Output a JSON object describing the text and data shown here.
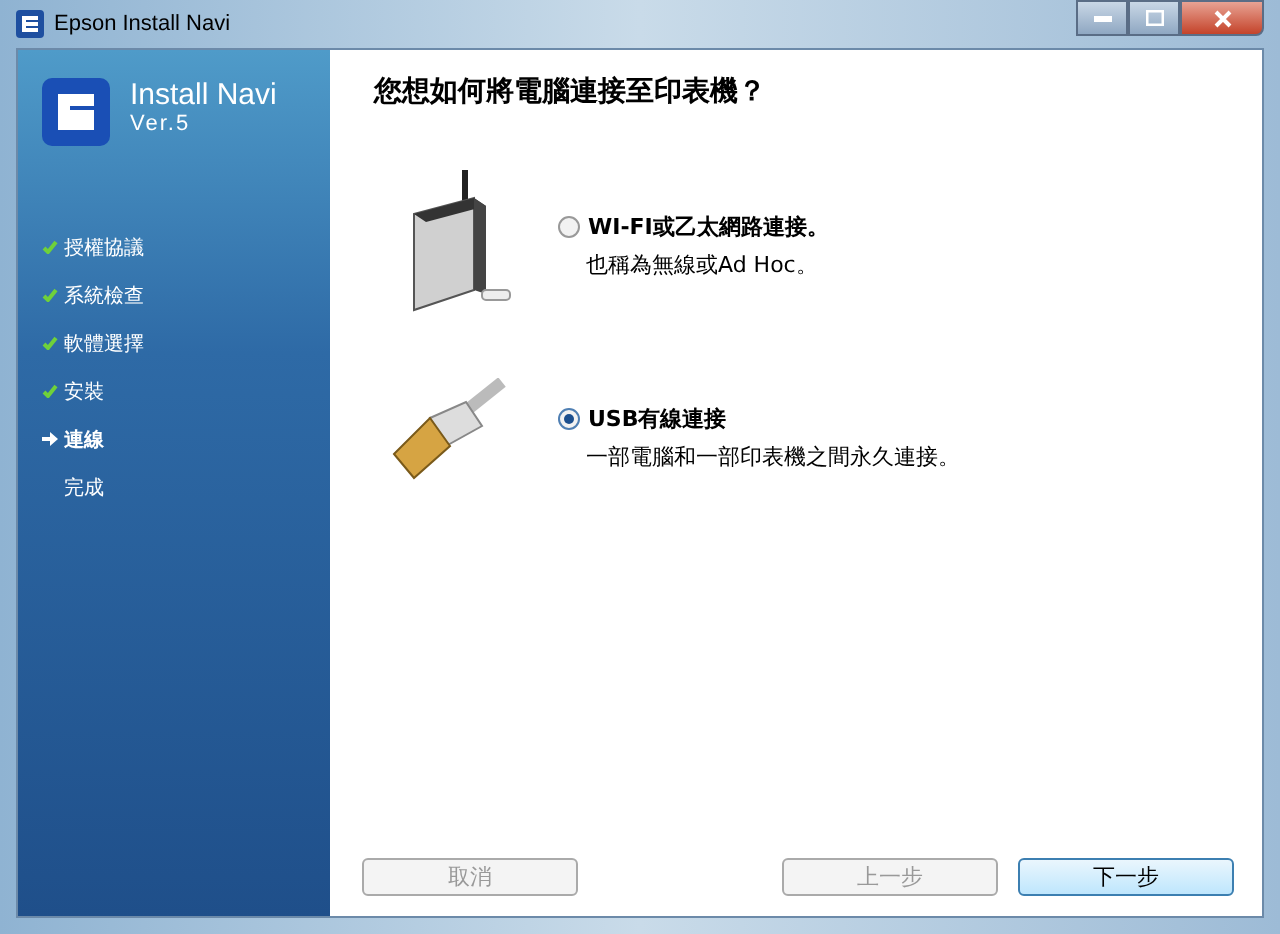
{
  "window": {
    "title": "Epson Install Navi"
  },
  "brand": {
    "name": "Install Navi",
    "version": "Ver.5"
  },
  "steps": [
    {
      "label": "授權協議",
      "completed": true,
      "selected": false
    },
    {
      "label": "系統檢查",
      "completed": true,
      "selected": false
    },
    {
      "label": "軟體選擇",
      "completed": true,
      "selected": false
    },
    {
      "label": "安裝",
      "completed": true,
      "selected": false
    },
    {
      "label": "連線",
      "completed": false,
      "selected": true
    },
    {
      "label": "完成",
      "completed": false,
      "selected": false
    }
  ],
  "heading": "您想如何將電腦連接至印表機？",
  "options": [
    {
      "kind": "network",
      "label": "WI-FI或乙太網路連接。",
      "description": "也稱為無線或Ad Hoc。",
      "selected": false
    },
    {
      "kind": "usb",
      "label": "USB有線連接",
      "description": "一部電腦和一部印表機之間永久連接。",
      "selected": true
    }
  ],
  "buttons": [
    {
      "label": "取消",
      "disabled": true
    },
    {
      "label": "上一步",
      "disabled": true
    },
    {
      "label": "下一步",
      "disabled": false
    }
  ]
}
